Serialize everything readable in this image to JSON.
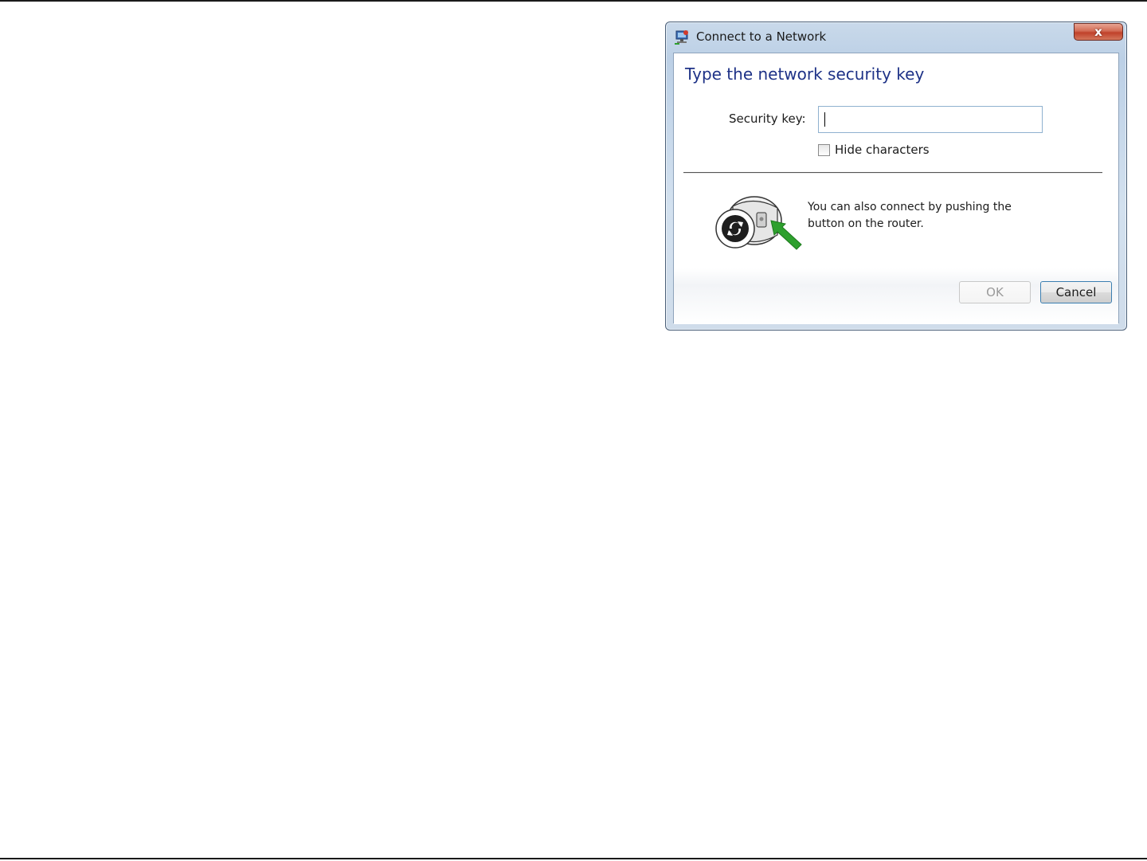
{
  "window": {
    "title": "Connect to a Network",
    "close_glyph": "x"
  },
  "dialog": {
    "heading": "Type the network security key",
    "security_key_label": "Security key:",
    "security_key_value": "",
    "hide_characters_label": "Hide characters",
    "hide_characters_checked": false,
    "wps_text": "You can also connect by pushing the button on the router.",
    "ok_label": "OK",
    "ok_enabled": false,
    "cancel_label": "Cancel"
  },
  "colors": {
    "heading": "#1e3287",
    "close_button": "#c0412a",
    "wps_arrow": "#2ea02e"
  },
  "icons": {
    "title": "network-connection-icon",
    "close": "close-icon",
    "wps": "wps-router-button-icon"
  }
}
